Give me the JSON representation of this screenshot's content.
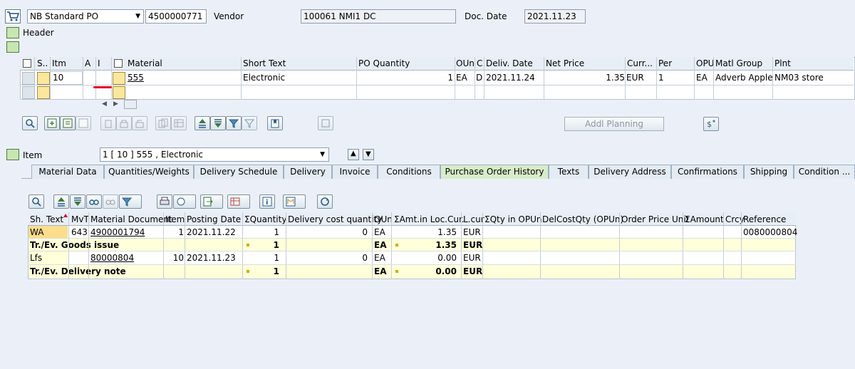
{
  "header": {
    "po_type": "NB Standard PO",
    "po_number": "4500000771",
    "vendor_label": "Vendor",
    "vendor_value": "100061 NMI1 DC",
    "doc_date_label": "Doc. Date",
    "doc_date_value": "2021.11.23",
    "header_label": "Header"
  },
  "items_table": {
    "columns": [
      "S..",
      "Itm",
      "A",
      "I",
      "Material",
      "Short Text",
      "PO Quantity",
      "OUn",
      "C",
      "Deliv. Date",
      "Net Price",
      "Curr...",
      "Per",
      "OPU",
      "Matl Group",
      "Plnt"
    ],
    "row": {
      "itm": "10",
      "material": "555",
      "short_text": "Electronic",
      "po_qty": "1",
      "oun": "EA",
      "c": "D",
      "deliv_date": "2021.11.24",
      "net_price": "1.35",
      "curr": "EUR",
      "per": "1",
      "opu": "EA",
      "matl_group": "Adverb Apple",
      "plnt": "NM03 store"
    }
  },
  "toolbar": {
    "addl_planning": "Addl Planning"
  },
  "item_section": {
    "label": "Item",
    "selector": "1 [ 10 ] 555 , Electronic"
  },
  "tabs": [
    "Material Data",
    "Quantities/Weights",
    "Delivery Schedule",
    "Delivery",
    "Invoice",
    "Conditions",
    "Purchase Order History",
    "Texts",
    "Delivery Address",
    "Confirmations",
    "Shipping",
    "Condition ..."
  ],
  "history": {
    "columns": [
      "Sh. Text",
      "MvT",
      "Material Document",
      "Item",
      "Posting Date",
      "ΣQuantity",
      "Delivery cost quantity",
      "OUn",
      "ΣAmt.in Loc.Cur.",
      "L.cur",
      "ΣQty in OPUn",
      "DelCostQty (OPUn)",
      "Order Price Unit",
      "ΣAmount",
      "Crcy",
      "Reference"
    ],
    "rows": [
      {
        "sh_text": "WA",
        "mvt": "643",
        "mat_doc": "4900001794",
        "item": "1",
        "posting_date": "2021.11.22",
        "qty": "1",
        "del_cost_qty": "0",
        "oun": "EA",
        "amt": "1.35",
        "lcur": "EUR",
        "reference": "0080000804"
      },
      {
        "label": "Tr./Ev. Goods issue",
        "qty": "1",
        "oun": "EA",
        "amt": "1.35",
        "lcur": "EUR"
      },
      {
        "sh_text": "Lfs",
        "mvt": "",
        "mat_doc": "80000804",
        "item": "10",
        "posting_date": "2021.11.23",
        "qty": "1",
        "del_cost_qty": "0",
        "oun": "EA",
        "amt": "0.00",
        "lcur": "EUR",
        "reference": ""
      },
      {
        "label": "Tr./Ev. Delivery note",
        "qty": "1",
        "oun": "EA",
        "amt": "0.00",
        "lcur": "EUR"
      }
    ]
  },
  "colors": {
    "yellow_row": "#ffffd9",
    "active_tab": "#d7ecc9",
    "annotation_red": "#e0002a"
  }
}
